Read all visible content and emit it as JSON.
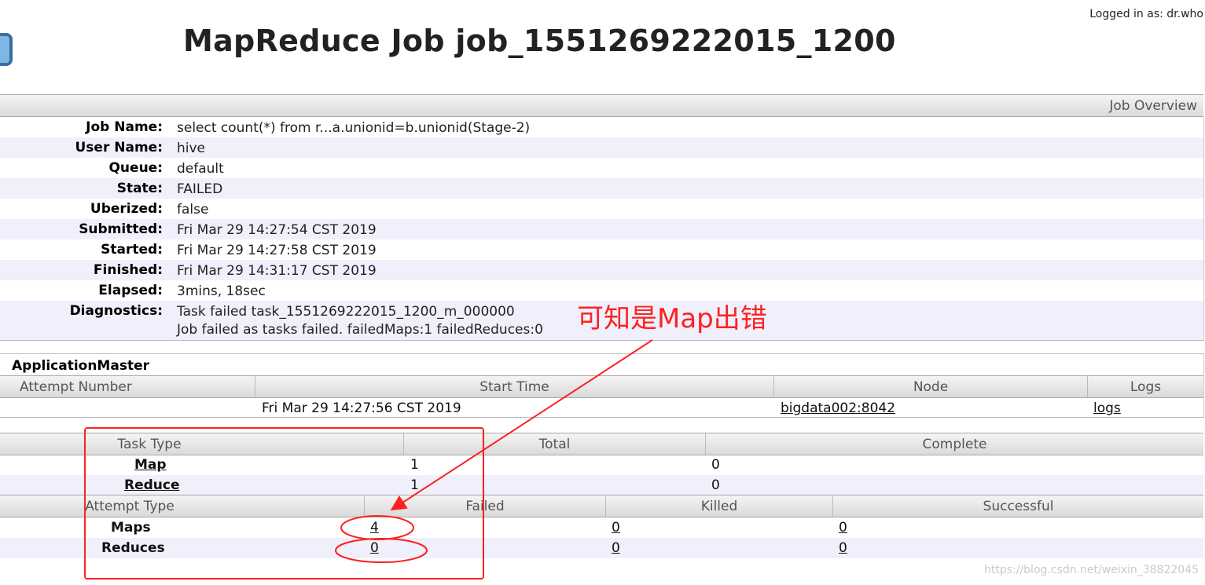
{
  "header": {
    "logged_in": "Logged in as: dr.who",
    "title": "MapReduce Job job_1551269222015_1200"
  },
  "job_overview": {
    "section_label": "Job Overview",
    "rows": [
      {
        "key": "Job Name:",
        "value": "select count(*) from r...a.unionid=b.unionid(Stage-2)"
      },
      {
        "key": "User Name:",
        "value": "hive"
      },
      {
        "key": "Queue:",
        "value": "default"
      },
      {
        "key": "State:",
        "value": "FAILED"
      },
      {
        "key": "Uberized:",
        "value": "false"
      },
      {
        "key": "Submitted:",
        "value": "Fri Mar 29 14:27:54 CST 2019"
      },
      {
        "key": "Started:",
        "value": "Fri Mar 29 14:27:58 CST 2019"
      },
      {
        "key": "Finished:",
        "value": "Fri Mar 29 14:31:17 CST 2019"
      },
      {
        "key": "Elapsed:",
        "value": "3mins, 18sec"
      }
    ],
    "diagnostics": {
      "key": "Diagnostics:",
      "line1": "Task failed task_1551269222015_1200_m_000000",
      "line2": "Job failed as tasks failed. failedMaps:1 failedReduces:0"
    }
  },
  "application_master": {
    "title": "ApplicationMaster",
    "columns": [
      "Attempt Number",
      "Start Time",
      "Node",
      "Logs"
    ],
    "row": {
      "attempt": "",
      "start_time": "Fri Mar 29 14:27:56 CST 2019",
      "node": "bigdata002:8042",
      "logs": "logs"
    }
  },
  "tasks": {
    "columns": [
      "Task Type",
      "Total",
      "Complete"
    ],
    "rows": [
      {
        "type": "Map",
        "total": "1",
        "complete": "0"
      },
      {
        "type": "Reduce",
        "total": "1",
        "complete": "0"
      }
    ]
  },
  "attempts": {
    "columns": [
      "Attempt Type",
      "Failed",
      "Killed",
      "Successful"
    ],
    "rows": [
      {
        "type": "Maps",
        "failed": "4",
        "killed": "0",
        "successful": "0"
      },
      {
        "type": "Reduces",
        "failed": "0",
        "killed": "0",
        "successful": "0"
      }
    ]
  },
  "annotation": {
    "note": "可知是Map出错",
    "color": "#ff2020"
  },
  "watermark": "https://blog.csdn.net/weixin_38822045"
}
